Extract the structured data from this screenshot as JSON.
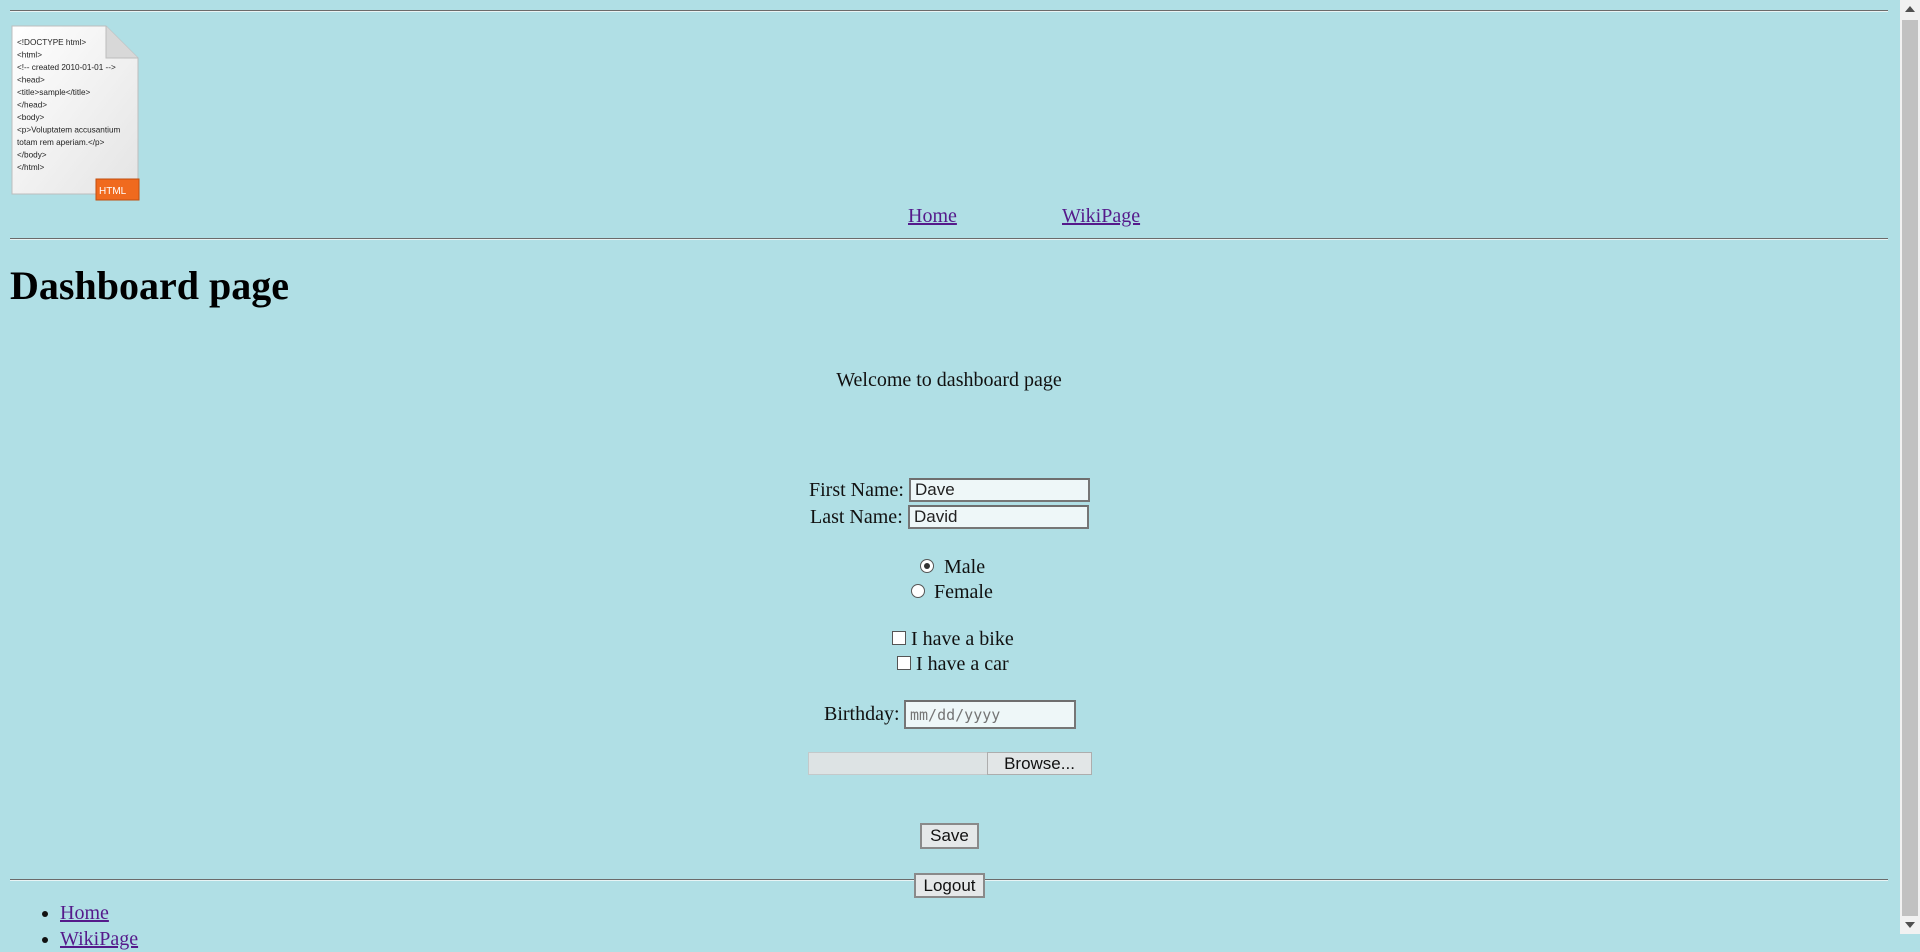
{
  "nav": {
    "home": "Home",
    "wiki": "WikiPage"
  },
  "logo": {
    "lines": [
      "<!DOCTYPE html>",
      "<html>",
      "<!-- created 2010-01-01 -->",
      "<head>",
      " <title>sample</title>",
      "</head>",
      "<body>",
      " <p>Voluptatem accusantium",
      "  totam rem aperiam.</p>",
      "</body>",
      "</html>"
    ],
    "badge": "HTML"
  },
  "page": {
    "title": "Dashboard page",
    "welcome": "Welcome to dashboard page"
  },
  "form": {
    "first_name_label": "First Name:",
    "first_name_value": "Dave",
    "last_name_label": "Last Name:",
    "last_name_value": "David",
    "gender_male": "Male",
    "gender_female": "Female",
    "vehicle_bike": "I have a bike",
    "vehicle_car": "I have a car",
    "birthday_label": "Birthday:",
    "birthday_placeholder": "mm/dd/yyyy",
    "browse_label": "Browse...",
    "save_label": "Save",
    "logout_label": "Logout"
  },
  "footer_list": [
    "Home",
    "WikiPage"
  ],
  "colors": {
    "background": "#b0dfe5",
    "link": "#551a8b",
    "badge": "#f06a1e"
  }
}
